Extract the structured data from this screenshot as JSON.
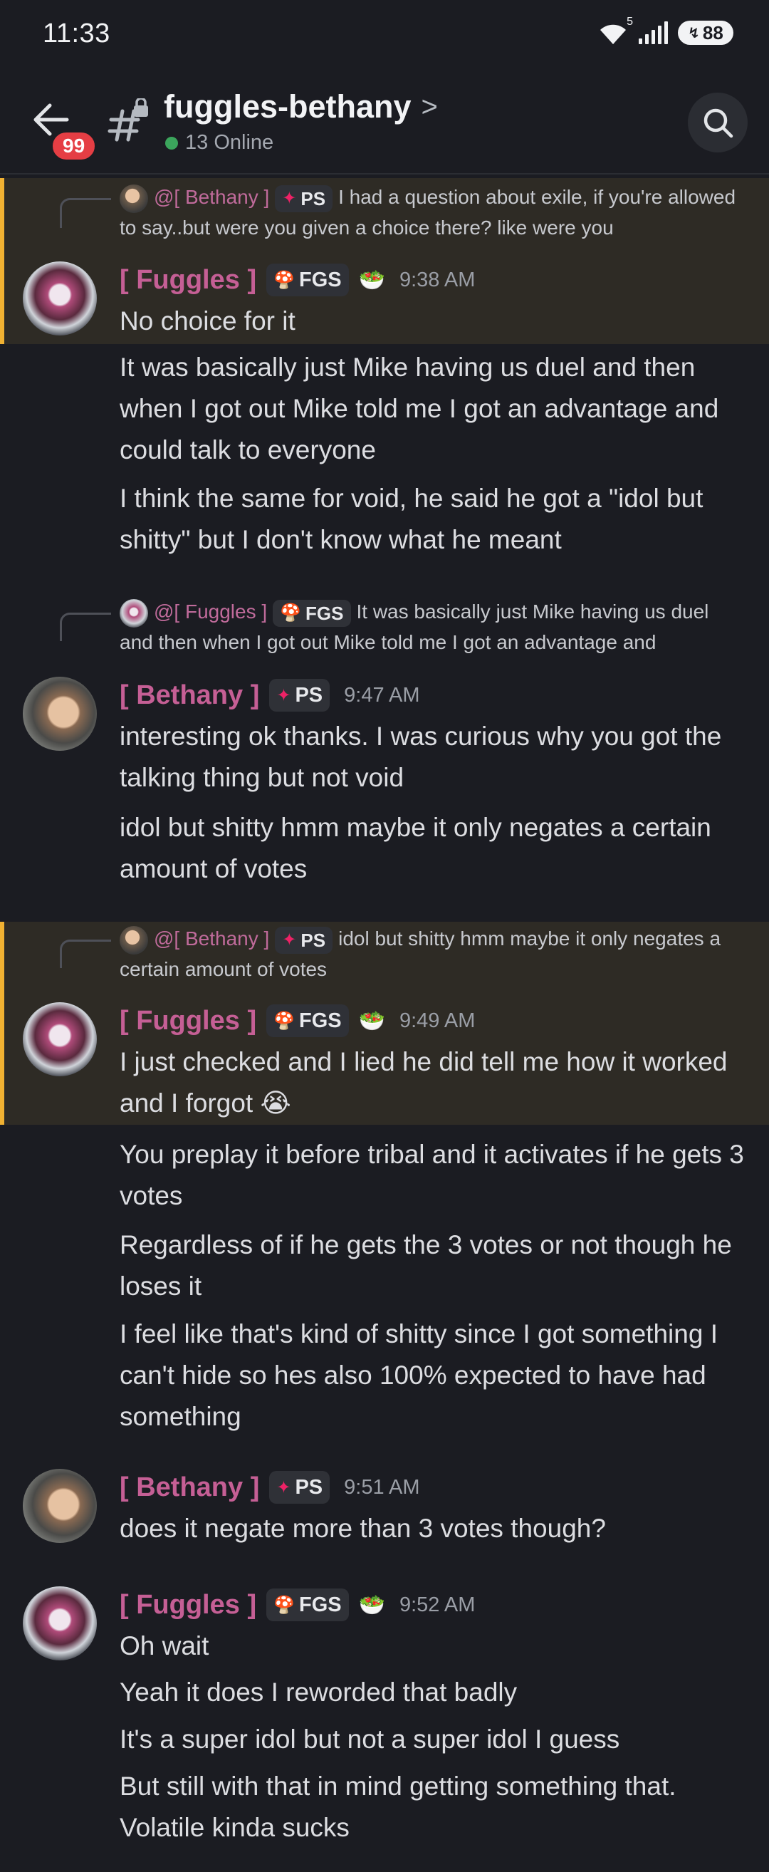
{
  "status": {
    "time": "11:33",
    "wifi_sup": "5",
    "battery": "88"
  },
  "header": {
    "badge": "99",
    "channel": "fuggles-bethany",
    "chevron": ">",
    "online": "13 Online"
  },
  "tags": {
    "fgs": "FGS",
    "ps": "PS"
  },
  "authors": {
    "fuggles": "[ Fuggles ]",
    "bethany": "[ Bethany ]"
  },
  "messages": [
    {
      "reply_mention": "@[ Bethany ]",
      "reply_text": "I had a question about exile, if you're allowed to say..but were you given a choice there? like were you",
      "time": "9:38 AM",
      "lines": [
        "No choice for it",
        "It was basically just Mike having us duel and then when I got out Mike told me I got an advantage and could talk to everyone",
        "I think the same for void, he said he got a \"idol but shitty\" but I don't know what he meant"
      ]
    },
    {
      "reply_mention": "@[ Fuggles ]",
      "reply_text": "It was basically just Mike having us duel and then when I got out Mike told me I got an advantage and",
      "time": "9:47 AM",
      "lines": [
        "interesting ok thanks. I was curious why you got the talking thing but not void",
        "idol but shitty hmm maybe it only negates a certain amount of votes"
      ]
    },
    {
      "reply_mention": "@[ Bethany ]",
      "reply_text": "idol but shitty hmm maybe it only negates a certain amount of votes",
      "time": "9:49 AM",
      "lines": [
        "I just checked and I lied he did tell me how it worked and I forgot",
        "You preplay it before tribal and it activates if he gets 3 votes",
        "Regardless of if he gets the 3 votes or not though he loses it",
        "I feel like that's kind of shitty since I got something I can't hide so hes also 100% expected to have had something"
      ],
      "emoji": "😭"
    },
    {
      "time": "9:51 AM",
      "lines": [
        "does it negate more than 3 votes though?"
      ]
    },
    {
      "time": "9:52 AM",
      "lines": [
        "Oh wait",
        "Yeah it does I reworded that badly",
        "It's a super idol but not a super idol I guess",
        "But still with that in mind getting something that. Volatile kinda sucks"
      ]
    }
  ]
}
